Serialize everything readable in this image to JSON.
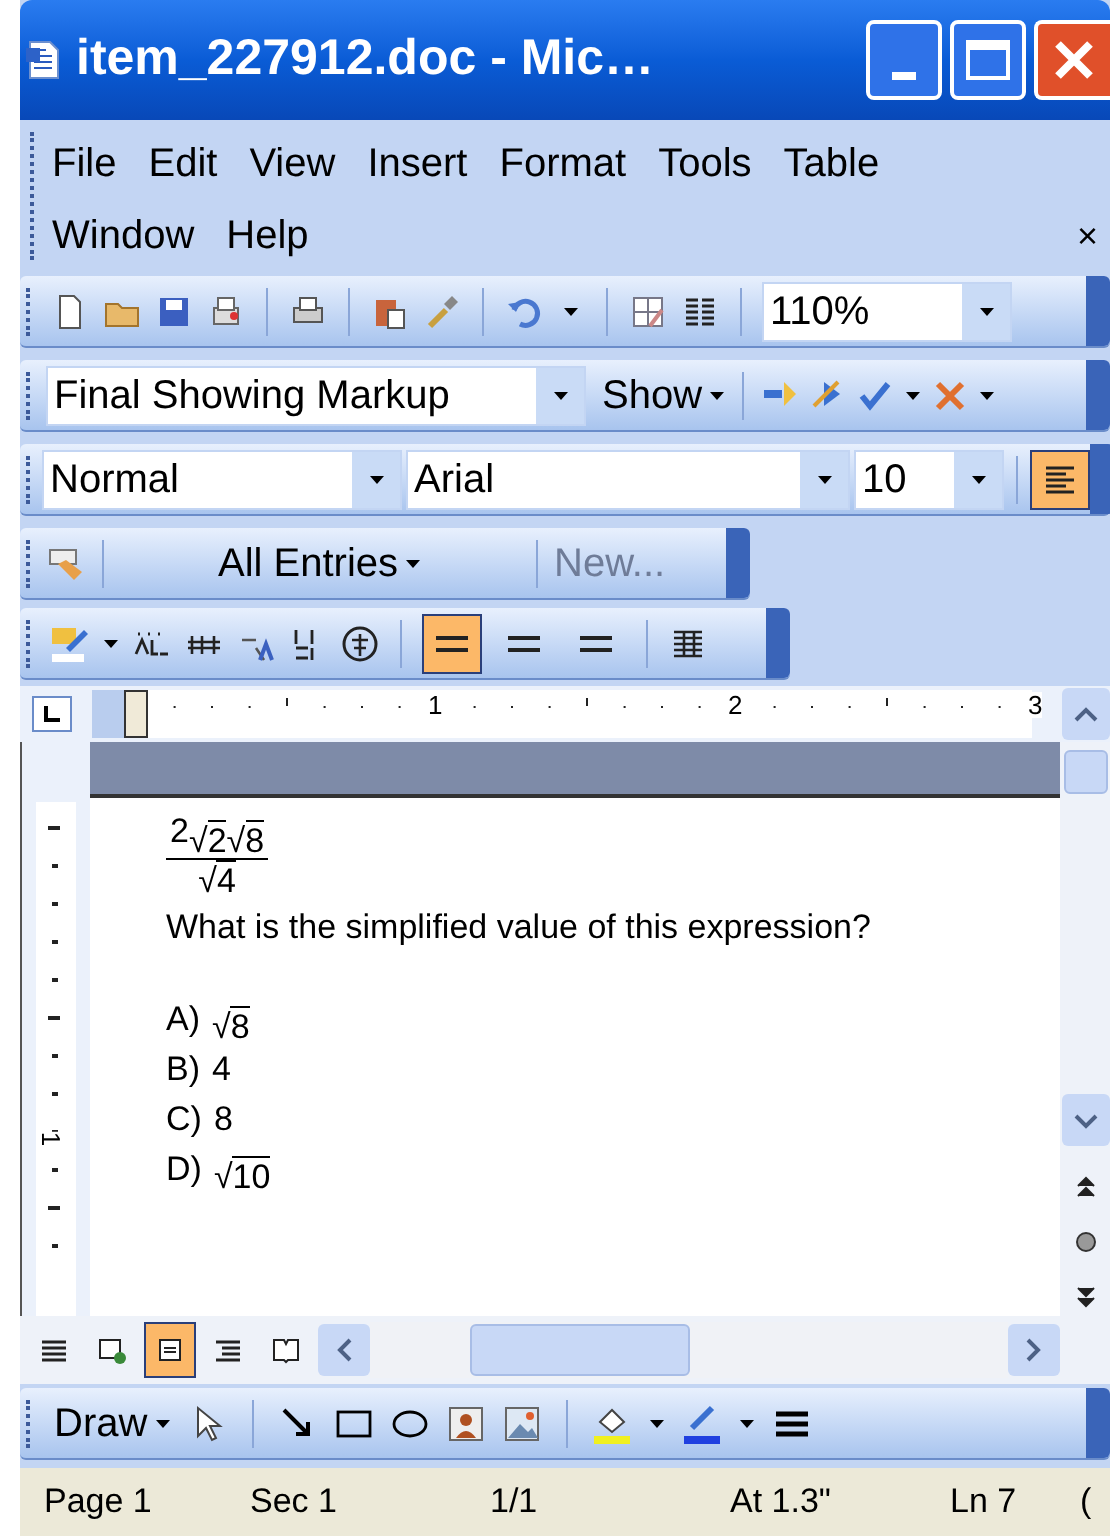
{
  "window": {
    "title": "item_227912.doc - Mic…"
  },
  "menu": {
    "items": [
      "File",
      "Edit",
      "View",
      "Insert",
      "Format",
      "Tools",
      "Table",
      "Window",
      "Help"
    ],
    "close": "×"
  },
  "standard_toolbar": {
    "zoom": "110%"
  },
  "reviewing_toolbar": {
    "display": "Final Showing Markup",
    "show": "Show"
  },
  "formatting_toolbar": {
    "style": "Normal",
    "font": "Arial",
    "size": "10",
    "align_left": {
      "selected": true
    }
  },
  "autotext_toolbar": {
    "entries": "All Entries",
    "new": {
      "label": "New...",
      "disabled": true
    }
  },
  "asian_toolbar": {
    "line_buttons": [
      {
        "selected": true
      },
      {
        "selected": false
      },
      {
        "selected": false
      }
    ]
  },
  "ruler": {
    "labels": [
      "1",
      "2",
      "3"
    ],
    "vertical_label": "1"
  },
  "document": {
    "numerator": [
      {
        "kind": "text",
        "text": "2"
      },
      {
        "kind": "root",
        "sign": "√",
        "text": "2"
      },
      {
        "kind": "root",
        "sign": "√",
        "text": "8"
      }
    ],
    "denominator": [
      {
        "kind": "root",
        "sign": "√",
        "text": "4"
      }
    ],
    "question": "What is the simplified value of this expression?",
    "options": [
      {
        "label": "A)",
        "value": [
          {
            "kind": "root",
            "sign": "√",
            "text": "8"
          }
        ]
      },
      {
        "label": "B)",
        "value": [
          {
            "kind": "text",
            "text": "4"
          }
        ]
      },
      {
        "label": "C)",
        "value": [
          {
            "kind": "text",
            "text": "8"
          }
        ]
      },
      {
        "label": "D)",
        "value": [
          {
            "kind": "root",
            "sign": "√",
            "text": "10"
          }
        ]
      }
    ]
  },
  "view_buttons": [
    {
      "selected": false
    },
    {
      "selected": false
    },
    {
      "selected": true
    },
    {
      "selected": false
    },
    {
      "selected": false
    }
  ],
  "draw_toolbar": {
    "draw": "Draw"
  },
  "status_bar": [
    "Page 1",
    "Sec 1",
    "1/1",
    "At 1.3\"",
    "Ln 7",
    "("
  ]
}
